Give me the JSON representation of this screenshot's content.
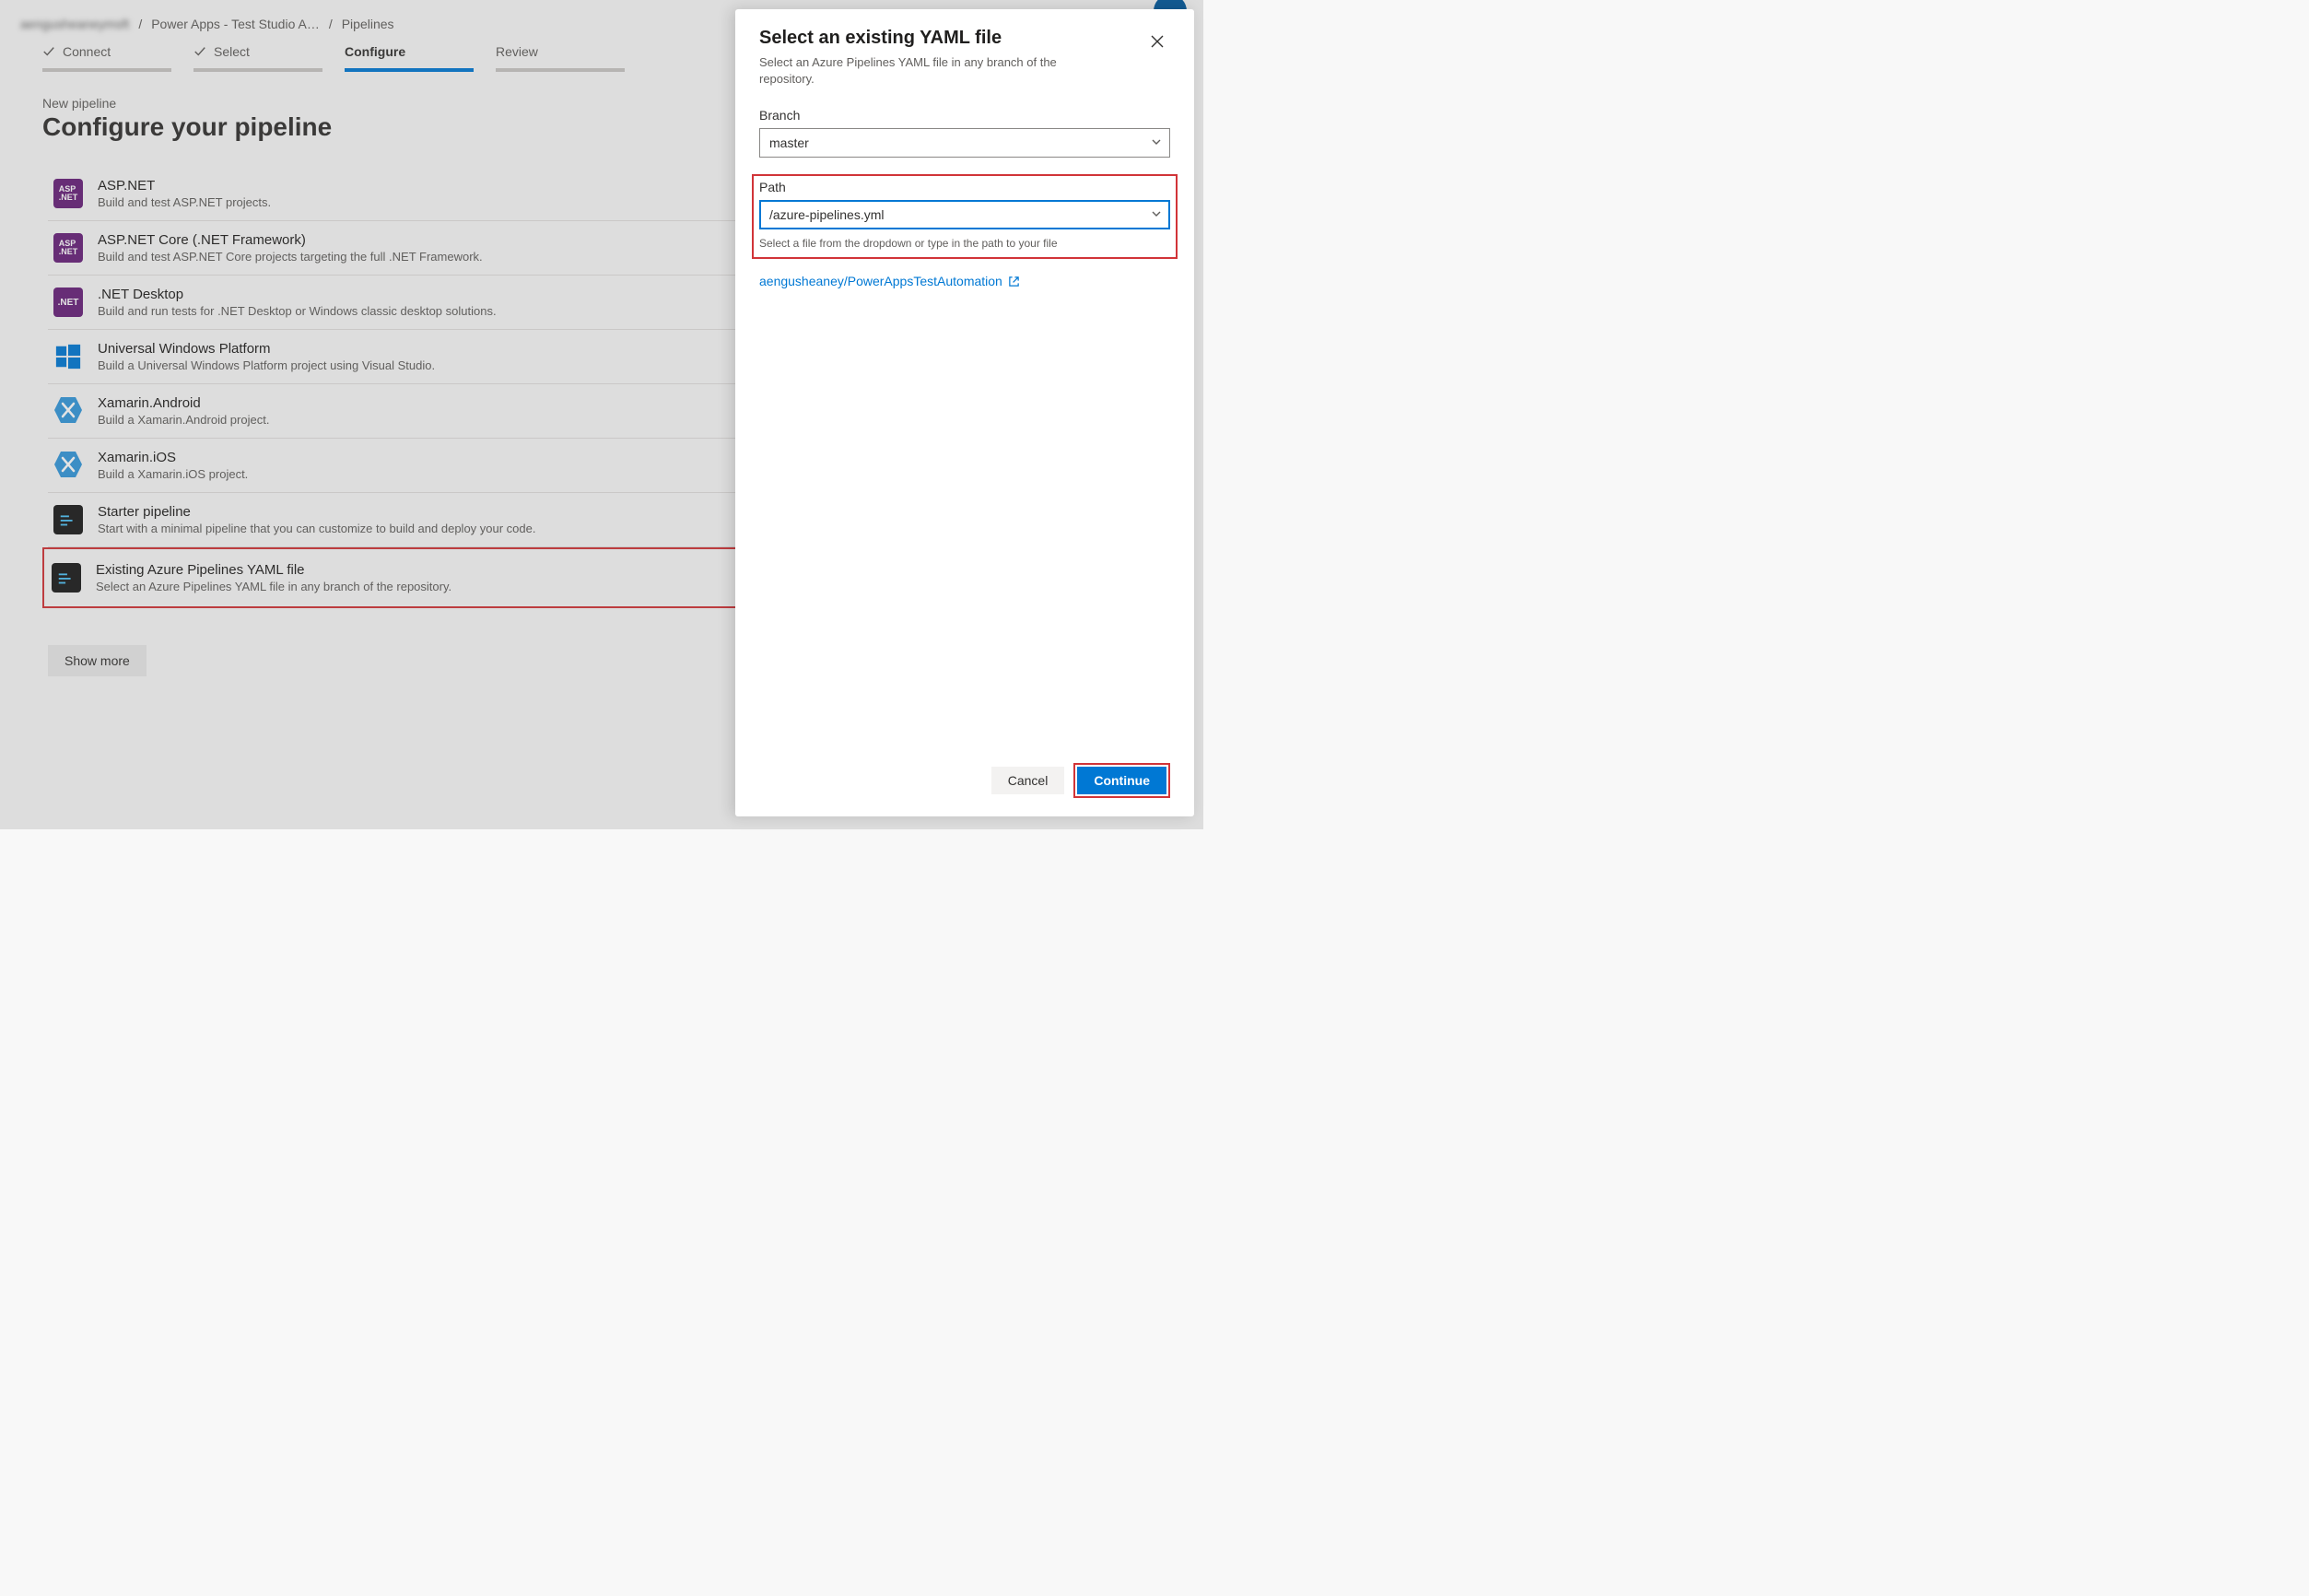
{
  "breadcrumb": {
    "org": "aengusheaneymsft",
    "project": "Power Apps - Test Studio A…",
    "leaf": "Pipelines"
  },
  "stepper": {
    "steps": [
      {
        "label": "Connect",
        "state": "done"
      },
      {
        "label": "Select",
        "state": "done"
      },
      {
        "label": "Configure",
        "state": "active"
      },
      {
        "label": "Review",
        "state": "pending"
      }
    ]
  },
  "page": {
    "subLabel": "New pipeline",
    "title": "Configure your pipeline"
  },
  "options": [
    {
      "icon": "aspnet",
      "title": "ASP.NET",
      "desc": "Build and test ASP.NET projects."
    },
    {
      "icon": "aspnet-core",
      "title": "ASP.NET Core (.NET Framework)",
      "desc": "Build and test ASP.NET Core projects targeting the full .NET Framework."
    },
    {
      "icon": "net",
      "title": ".NET Desktop",
      "desc": "Build and run tests for .NET Desktop or Windows classic desktop solutions."
    },
    {
      "icon": "windows",
      "title": "Universal Windows Platform",
      "desc": "Build a Universal Windows Platform project using Visual Studio."
    },
    {
      "icon": "xamarin",
      "title": "Xamarin.Android",
      "desc": "Build a Xamarin.Android project."
    },
    {
      "icon": "xamarin",
      "title": "Xamarin.iOS",
      "desc": "Build a Xamarin.iOS project."
    },
    {
      "icon": "code",
      "title": "Starter pipeline",
      "desc": "Start with a minimal pipeline that you can customize to build and deploy your code."
    },
    {
      "icon": "code",
      "title": "Existing Azure Pipelines YAML file",
      "desc": "Select an Azure Pipelines YAML file in any branch of the repository."
    }
  ],
  "showMore": "Show more",
  "panel": {
    "title": "Select an existing YAML file",
    "sub": "Select an Azure Pipelines YAML file in any branch of the repository.",
    "branchLabel": "Branch",
    "branchValue": "master",
    "pathLabel": "Path",
    "pathValue": "/azure-pipelines.yml",
    "pathHelper": "Select a file from the dropdown or type in the path to your file",
    "repoLink": "aengusheaney/PowerAppsTestAutomation",
    "cancel": "Cancel",
    "continue": "Continue"
  }
}
